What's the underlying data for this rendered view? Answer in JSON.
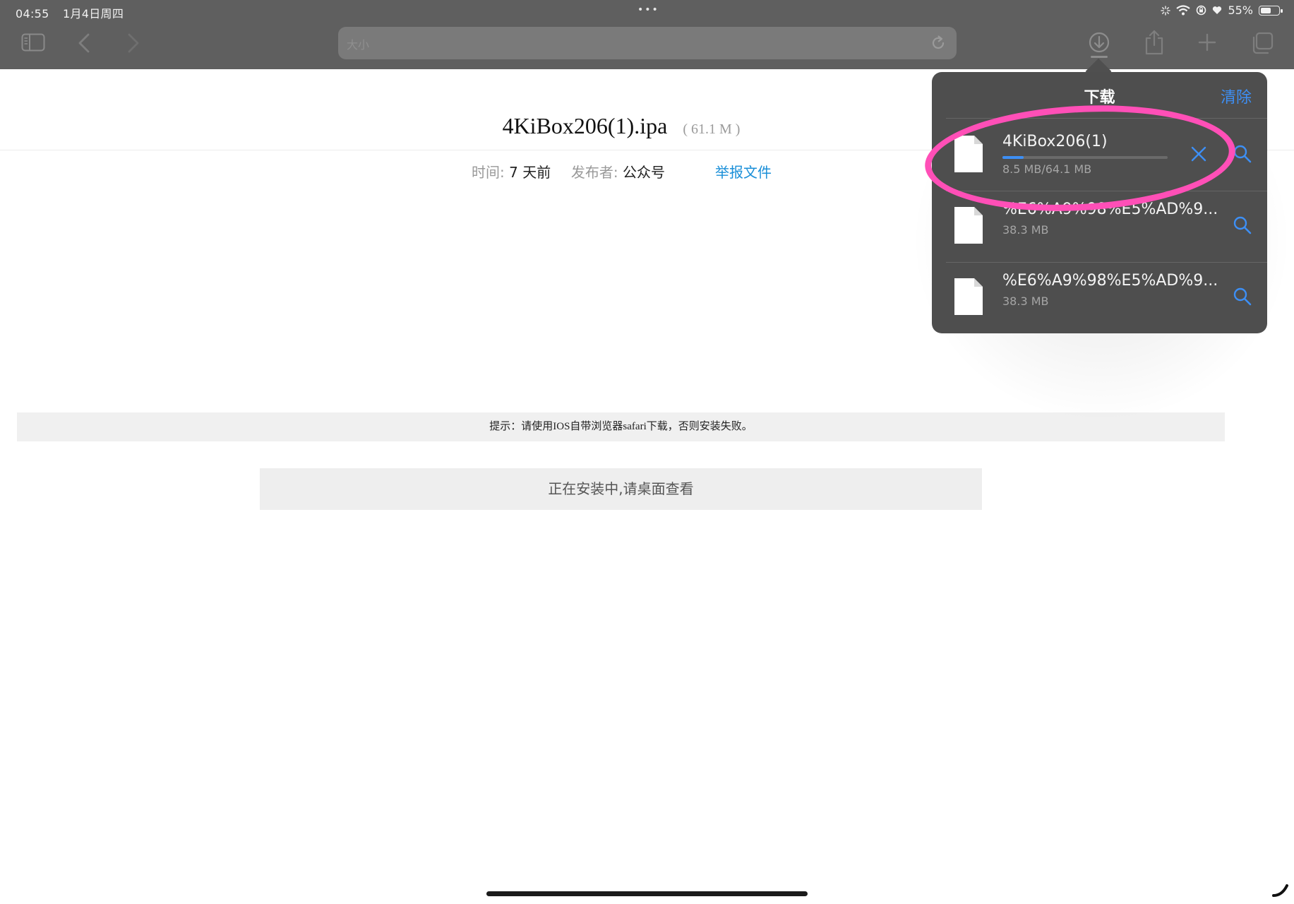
{
  "status_bar": {
    "time": "04:55",
    "date": "1月4日周四",
    "dots": "•••",
    "battery_text": "55%"
  },
  "browser": {
    "url_text": "大小",
    "icons": [
      "sidebar-icon",
      "back-chevron-icon",
      "forward-chevron-icon",
      "reload-icon",
      "download-icon",
      "share-icon",
      "plus-icon",
      "tabs-icon"
    ]
  },
  "page": {
    "file_name": "4KiBox206(1).ipa",
    "file_size": "( 61.1 M )",
    "meta": {
      "time_label": "时间:",
      "time_value": "7 天前",
      "publisher_label": "发布者:",
      "publisher_value": "公众号"
    },
    "report_link": "举报文件",
    "hint": "提示：请使用IOS自带浏览器safari下载，否则安装失败。",
    "install_button": "正在安装中,请桌面查看"
  },
  "downloads": {
    "title": "下载",
    "clear_label": "清除",
    "accent": "#3d8ff5",
    "items": [
      {
        "name": "4KiBox206(1)",
        "size": "8.5 MB/64.1 MB",
        "progress": 0.13,
        "icon": "file-icon",
        "in_progress": true
      },
      {
        "name": "%E6%A9%98%E5%AD%9...",
        "size": "38.3 MB",
        "icon": "file-icon"
      },
      {
        "name": "%E6%A9%98%E5%AD%9...",
        "size": "38.3 MB",
        "icon": "file-icon"
      }
    ]
  },
  "annotation_color": "#ff4fb7"
}
